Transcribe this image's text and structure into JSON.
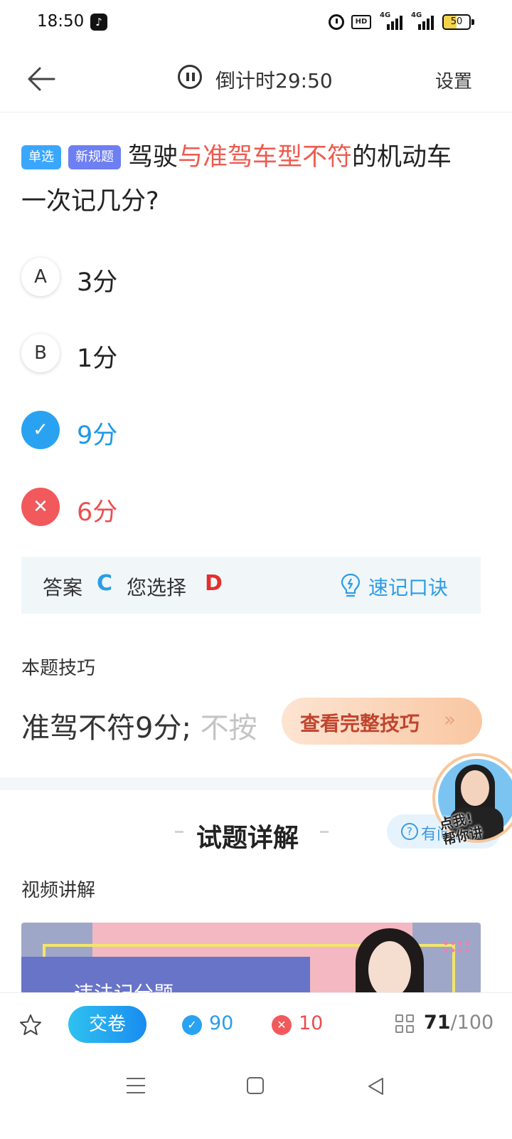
{
  "status_bar": {
    "time": "18:50",
    "icons": [
      "tiktok-icon",
      "alarm-icon",
      "hd-icon",
      "signal-4g-icon",
      "signal-4g-icon",
      "battery-icon"
    ],
    "hd_label": "HD",
    "network_label": "4G",
    "battery_level": "50"
  },
  "header": {
    "countdown": "倒计时29:50",
    "settings_label": "设置"
  },
  "question": {
    "tags": [
      "单选",
      "新规题"
    ],
    "text_before": "驾驶",
    "text_highlight": "与准驾车型不符",
    "text_after": "的机动车一次记几分?"
  },
  "options": [
    {
      "letter": "A",
      "text": "3分",
      "state": "normal"
    },
    {
      "letter": "B",
      "text": "1分",
      "state": "normal"
    },
    {
      "letter": "✓",
      "text": "9分",
      "state": "correct"
    },
    {
      "letter": "✕",
      "text": "6分",
      "state": "wrong"
    }
  ],
  "answer_bar": {
    "answer_label": "答案",
    "answer_value": "C",
    "selected_label": "您选择",
    "selected_value": "D",
    "memo_label": "速记口诀"
  },
  "technique": {
    "section_label": "本题技巧",
    "text_visible": "准驾不符9分;",
    "text_faded": "不按",
    "button_label": "查看完整技巧",
    "button_arrow": "»"
  },
  "details": {
    "title": "试题详解",
    "help_label": "有问题",
    "video_label": "视频讲解",
    "video_thumb_title": "违法记分题"
  },
  "avatar_badge": {
    "text_line1": "点我!",
    "text_line2": "帮你讲"
  },
  "bottom_bar": {
    "submit_label": "交卷",
    "correct_count": "90",
    "wrong_count": "10",
    "current_index": "71",
    "total": "/100"
  },
  "colors": {
    "accent_blue": "#2aa2f2",
    "error_red": "#f2595c",
    "highlight_red": "#ef5a4f",
    "tag_blue": "#3aa7ff",
    "tag_purple": "#6e7ff2"
  }
}
